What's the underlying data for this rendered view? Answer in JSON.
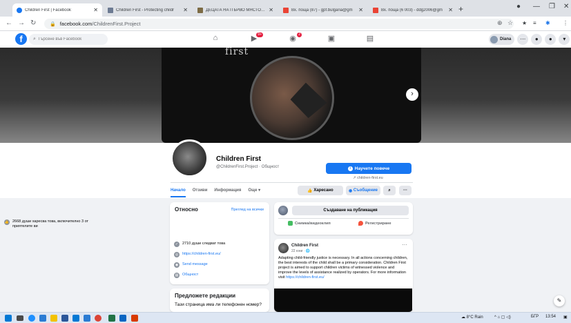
{
  "browser": {
    "tabs": [
      {
        "title": "Children First | Facebook",
        "active": true,
        "color": "#1877f2"
      },
      {
        "title": "Children First - Protecting childr",
        "active": false,
        "color": "#6d7b93"
      },
      {
        "title": "ДЕЦАТА НА ПЪРВО МЯСТО: за",
        "active": false,
        "color": "#7d6c45"
      },
      {
        "title": "Вх. поща (87) - gpf.bulgaria@gm",
        "active": false,
        "color": "#ea4335"
      },
      {
        "title": "Вх. поща (6 003) - ddg2006@gm",
        "active": false,
        "color": "#ea4335"
      }
    ],
    "url_domain": "facebook.com",
    "url_path": "/ChildrenFirst.Project",
    "new_tab": "+",
    "profile_label": "Diana"
  },
  "fb": {
    "logo": "f",
    "search_placeholder": "Търсене във Facebook",
    "badge_watch": "9+",
    "badge_groups": "2",
    "user_name": "Diana"
  },
  "page": {
    "cover_text": "first",
    "name": "Children First",
    "handle": "@ChildrenFirst.Project · Общност",
    "learn_more": "Научете повече",
    "website": "children-first.eu",
    "tabs": [
      "Начало",
      "Отзиви",
      "Информация",
      "Още ▾"
    ],
    "like_label": "Харесано",
    "message_label": "Съобщение"
  },
  "about": {
    "title": "Относно",
    "see_all": "Преглед на всички",
    "likes": "2668 души харесва това, включително 3 от приятелите ви",
    "followers": "2710 души следват това",
    "website": "https://children-first.eu/",
    "send_message": "Send message",
    "category": "Общност"
  },
  "suggest": {
    "title": "Предложете редакции",
    "question": "Тази страница има ли телефонен номер?"
  },
  "composer": {
    "create_label": "Създаване на публикация",
    "photo_label": "Снимка/видеоклип",
    "checkin_label": "Регистриране"
  },
  "post": {
    "author": "Children First",
    "time": "22 юни · 🌐",
    "more": "···",
    "text": "Adapting child-friendly justice is necessary. In all actions concerning children, the best interests of the child shall be a primary consideration. Children First project is aimed to support children victims of witnessed violence and improve the levels of assistance realized by operators. For more information visit",
    "link": "https://children-first.eu/"
  },
  "taskbar": {
    "weather": "8°C  Rain",
    "lang": "БГР",
    "time": "13:54"
  }
}
